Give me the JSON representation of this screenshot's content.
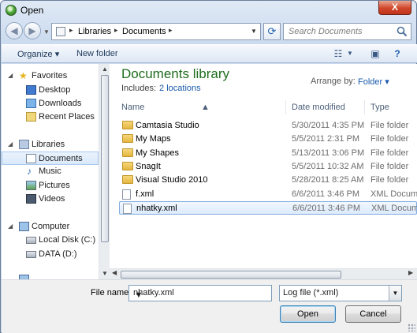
{
  "window": {
    "title": "Open",
    "close_label": "X"
  },
  "address": {
    "crumbs": [
      "Libraries",
      "Documents"
    ],
    "search_placeholder": "Search Documents"
  },
  "toolbar": {
    "organize": "Organize",
    "new_folder": "New folder"
  },
  "nav": {
    "favorites": "Favorites",
    "fav_items": [
      "Desktop",
      "Downloads",
      "Recent Places"
    ],
    "libraries": "Libraries",
    "lib_items": [
      "Documents",
      "Music",
      "Pictures",
      "Videos"
    ],
    "computer": "Computer",
    "drives": [
      "Local Disk (C:)",
      "DATA (D:)"
    ]
  },
  "library": {
    "title": "Documents library",
    "includes_label": "Includes:",
    "includes_link": "2 locations",
    "arrange_label": "Arrange by:",
    "arrange_value": "Folder"
  },
  "columns": {
    "name": "Name",
    "date": "Date modified",
    "type": "Type"
  },
  "files": [
    {
      "name": "Camtasia Studio",
      "date": "5/30/2011 4:35 PM",
      "type": "File folder",
      "kind": "folder"
    },
    {
      "name": "My Maps",
      "date": "5/5/2011 2:31 PM",
      "type": "File folder",
      "kind": "folder"
    },
    {
      "name": "My Shapes",
      "date": "5/13/2011 3:06 PM",
      "type": "File folder",
      "kind": "folder"
    },
    {
      "name": "SnagIt",
      "date": "5/5/2011 10:32 AM",
      "type": "File folder",
      "kind": "folder"
    },
    {
      "name": "Visual Studio 2010",
      "date": "5/28/2011 8:25 AM",
      "type": "File folder",
      "kind": "folder"
    },
    {
      "name": "f.xml",
      "date": "6/6/2011 3:46 PM",
      "type": "XML Docum",
      "kind": "xml"
    },
    {
      "name": "nhatky.xml",
      "date": "6/6/2011 3:46 PM",
      "type": "XML Docum",
      "kind": "xml",
      "selected": true
    }
  ],
  "bottom": {
    "filename_label": "File name:",
    "filename_value": "nhatky.xml",
    "filter_value": "Log file (*.xml)",
    "open_label": "Open",
    "cancel_label": "Cancel"
  }
}
